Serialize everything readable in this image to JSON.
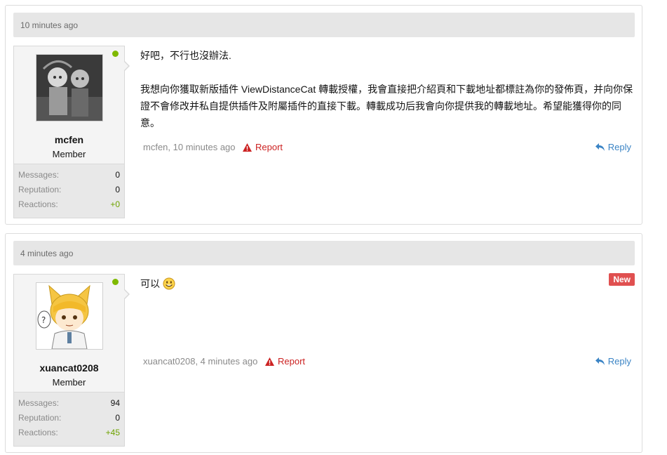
{
  "posts": [
    {
      "time": "10 minutes ago",
      "username": "mcfen",
      "user_title": "Member",
      "stats": [
        {
          "label": "Messages:",
          "value": "0"
        },
        {
          "label": "Reputation:",
          "value": "0"
        },
        {
          "label": "Reactions:",
          "value": "+0"
        }
      ],
      "message_lines": [
        "好吧，不行也沒辦法.",
        "我想向你獲取新版插件 ViewDistanceCat 轉載授權，我會直接把介紹頁和下載地址都標註為你的發佈頁，并向你保證不會修改并私自提供插件及附屬插件的直接下載。轉載成功后我會向你提供我的轉載地址。希望能獲得你的同意。"
      ],
      "meta": "mcfen, 10 minutes ago",
      "report": "Report",
      "reply": "Reply"
    },
    {
      "time": "4 minutes ago",
      "username": "xuancat0208",
      "user_title": "Member",
      "stats": [
        {
          "label": "Messages:",
          "value": "94"
        },
        {
          "label": "Reputation:",
          "value": "0"
        },
        {
          "label": "Reactions:",
          "value": "+45"
        }
      ],
      "message_lines": [
        "可以"
      ],
      "new_badge": "New",
      "meta": "xuancat0208, 4 minutes ago",
      "report": "Report",
      "reply": "Reply"
    }
  ],
  "colors": {
    "online": "#7fb900",
    "report": "#cc2222",
    "reply": "#3b84c5",
    "new_badge": "#e05050",
    "positive_reactions": "#6ea300"
  },
  "icons": [
    "warning-icon",
    "reply-arrow-icon",
    "smiley-icon",
    "online-indicator"
  ]
}
